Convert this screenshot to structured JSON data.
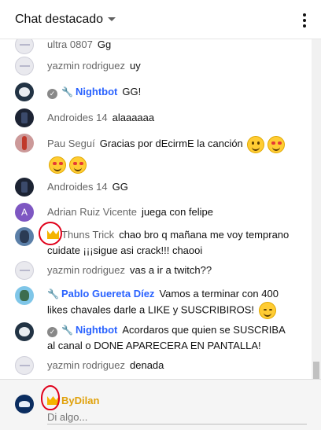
{
  "header": {
    "title": "Chat destacado"
  },
  "messages": [
    {
      "author": "ultra 0807",
      "text": "Gg",
      "avatar": "gray"
    },
    {
      "author": "yazmin rodriguez",
      "text": "uy",
      "avatar": "gray"
    },
    {
      "author": "Nightbot",
      "text": "GG!",
      "avatar": "bot",
      "role": "moderator"
    },
    {
      "author": "Androides 14",
      "text": "alaaaaaa",
      "avatar": "dark"
    },
    {
      "author": "Pau Seguí",
      "text": "Gracias por dEcirmE la canción",
      "avatar": "red",
      "emojis": [
        "smile",
        "heart-eyes",
        "heart-eyes",
        "heart-eyes"
      ]
    },
    {
      "author": "Androides 14",
      "text": "GG",
      "avatar": "dark"
    },
    {
      "author": "Adrian Ruiz Vicente",
      "text": "juega con felipe",
      "avatar": "letter",
      "avatar_letter": "A"
    },
    {
      "author": "Thuns Trick",
      "text": "chao bro q mañana me voy temprano cuidate ¡¡¡sigue asi crack!!! chaooi",
      "avatar": "thuns",
      "role": "member"
    },
    {
      "author": "yazmin rodriguez",
      "text": "vas a ir a twitch??",
      "avatar": "gray"
    },
    {
      "author": "Pablo Guereta Díez",
      "text": "Vamos a terminar con 400 likes chavales darle a LIKE y SUSCRIBIROS!",
      "avatar": "pablo",
      "role": "moderator"
    },
    {
      "author": "Nightbot",
      "text": "Acordaros que quien se SUSCRIBA al canal o DONE APARECERA EN PANTALLA!",
      "avatar": "bot",
      "role": "moderator"
    },
    {
      "author": "yazmin rodriguez",
      "text": "denada",
      "avatar": "gray"
    }
  ],
  "composer": {
    "author": "ByDilan",
    "placeholder": "Di algo..."
  },
  "colors": {
    "moderator": "#2962ff",
    "owner": "#e0a10b",
    "annotation": "#e0001a"
  }
}
